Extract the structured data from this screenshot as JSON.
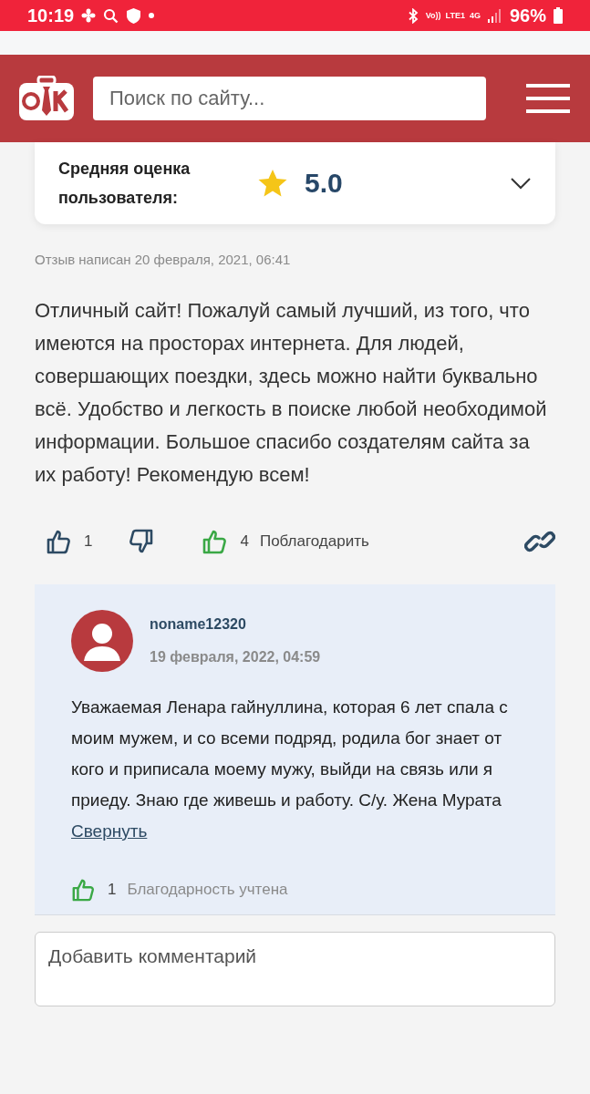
{
  "status_bar": {
    "time": "10:19",
    "network": [
      "Vo))",
      "LTE1",
      "4G"
    ],
    "battery": "96%"
  },
  "header": {
    "search": {
      "placeholder": "Поиск по сайту..."
    }
  },
  "rating": {
    "label": "Средняя оценка пользователя:",
    "value": "5.0",
    "expanded": false
  },
  "review": {
    "date": "Отзыв написан 20 февраля, 2021, 06:41",
    "text": "Отличный сайт! Пожалуй самый лучший, из того, что имеются на просторах интернета. Для людей, совершающих поездки, здесь можно найти буквально всё. Удобство и легкость в поиске любой необходимой информации. Большое спасибо создателям сайта за их работу! Рекомендую всем!",
    "likes": "1",
    "thanks_count": "4",
    "thanks_label": "Поблагодарить"
  },
  "comment": {
    "author": "noname12320",
    "date": "19 февраля, 2022, 04:59",
    "text": "Уважаемая Ленара гайнуллина, которая 6 лет спала с моим мужем, и со всеми подряд, родила бог знает от кого и приписала моему мужу, выйди на связь или я приеду. Знаю где живешь и работу. С/у. Жена Мурата",
    "collapse_link": "Свернуть",
    "thanks_count": "1",
    "thanks_label": "Благодарность учтена"
  },
  "add_comment": {
    "placeholder": "Добавить комментарий"
  }
}
